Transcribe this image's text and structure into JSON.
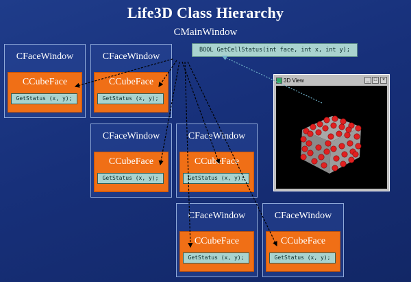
{
  "title": "Life3D Class Hierarchy",
  "main_window_label": "CMainWindow",
  "signature": "BOOL GetCellStatus(int face, int x, int y);",
  "face_windows": [
    {
      "label": "CFaceWindow",
      "cube_face_label": "CCubeFace",
      "method": "GetStatus (x, y);"
    },
    {
      "label": "CFaceWindow",
      "cube_face_label": "CCubeFace",
      "method": "GetStatus (x, y);"
    },
    {
      "label": "CFaceWindow",
      "cube_face_label": "CCubeFace",
      "method": "GetStatus (x, y);"
    },
    {
      "label": "CFaceWindow",
      "cube_face_label": "CCubeFace",
      "method": "GetStatus (x, y);"
    },
    {
      "label": "CFaceWindow",
      "cube_face_label": "CCubeFace",
      "method": "GetStatus (x, y);"
    },
    {
      "label": "CFaceWindow",
      "cube_face_label": "CCubeFace",
      "method": "GetStatus (x, y);"
    }
  ],
  "view3d": {
    "title": "3D View",
    "minimize_glyph": "_",
    "maximize_glyph": "□",
    "close_glyph": "×"
  },
  "colors": {
    "background": "#1a3580",
    "cube_face": "#f06f16",
    "method_box": "#a9d3cf",
    "cell_red": "#e02020",
    "cell_gray": "#9a9a9a"
  }
}
